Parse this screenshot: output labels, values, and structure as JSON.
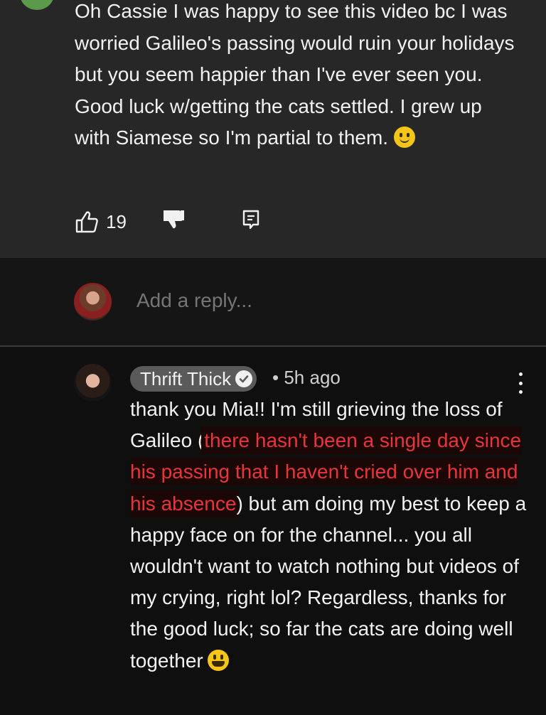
{
  "top_comment": {
    "text": "Oh Cassie I was happy to see this video bc I was worried Galileo's passing would ruin your holidays but you seem happier than I've ever seen you. Good luck w/getting the cats settled. I grew up with Siamese so I'm partial to them.",
    "emoji": "slightly-smiling-face",
    "like_count": "19",
    "icons": {
      "like": "thumbs-up-icon",
      "dislike": "thumbs-down-icon",
      "reply": "comment-icon"
    }
  },
  "reply_box": {
    "placeholder": "Add a reply..."
  },
  "reply": {
    "author": "Thrift Thick",
    "verified": true,
    "separator": "•",
    "time_ago": "5h ago",
    "text_before": "thank you Mia!! I'm still grieving the loss of Galileo (",
    "text_highlighted": "there hasn't been a single day since his passing that I haven't cried over him and his absence",
    "text_after": ") but am doing my best to keep a happy face on for the channel... you all wouldn't want to watch nothing but videos of my crying, right lol? Regardless, thanks for the good luck; so far the cats are doing well together",
    "emoji": "grinning-face",
    "highlight_color": "#e8353a"
  },
  "colors": {
    "top_comment_bg": "#272727",
    "page_bg": "#0f0f0f",
    "author_chip_bg": "#5a5a5a"
  }
}
